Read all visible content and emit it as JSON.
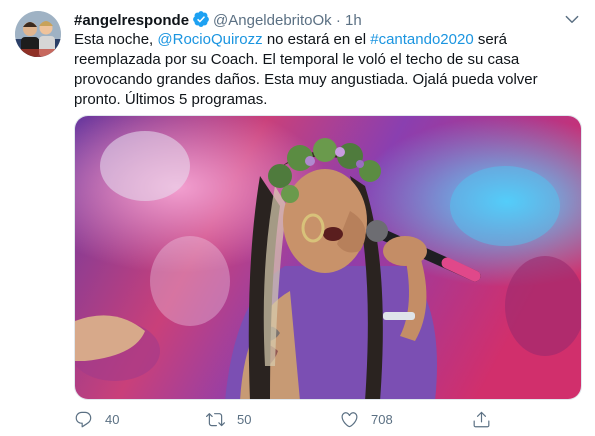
{
  "tweet": {
    "display_name": "#angelresponde",
    "handle": "@AngeldebritoOk",
    "separator": "·",
    "time": "1h",
    "text": {
      "part1": "Esta noche, ",
      "mention": "@RocioQuirozz",
      "part2": " no estará en el ",
      "hashtag": "#cantando2020",
      "part3": " será reemplazada por su Coach. El temporal le voló el techo de su casa provocando grandes daños. Esta muy angustiada. Ojalá pueda volver pronto. Últimos 5 programas."
    },
    "media_icon": "photo-of-singer-with-microphone",
    "actions": {
      "replies": "40",
      "retweets": "50",
      "likes": "708"
    }
  },
  "colors": {
    "link": "#1b95e0",
    "verified": "#1da1f2",
    "muted": "#5b7083"
  }
}
